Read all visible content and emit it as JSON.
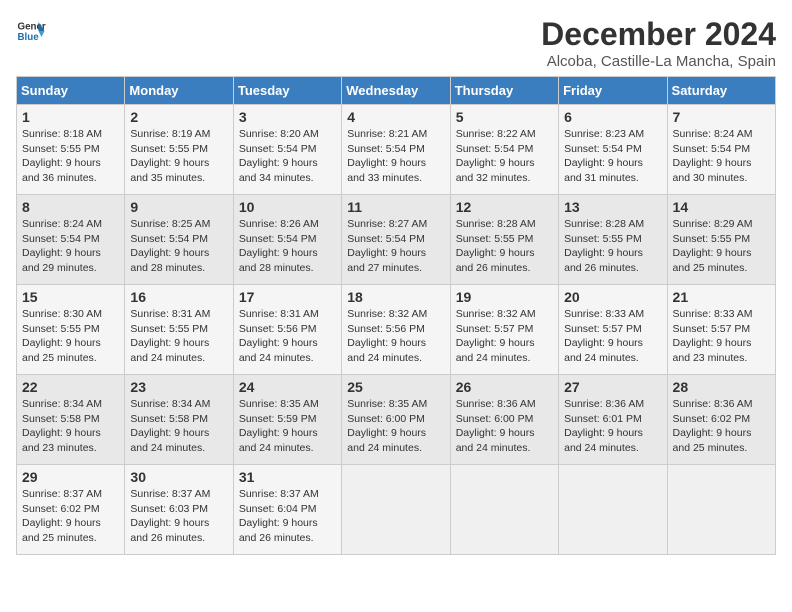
{
  "logo": {
    "line1": "General",
    "line2": "Blue"
  },
  "title": "December 2024",
  "subtitle": "Alcoba, Castille-La Mancha, Spain",
  "days_header": [
    "Sunday",
    "Monday",
    "Tuesday",
    "Wednesday",
    "Thursday",
    "Friday",
    "Saturday"
  ],
  "weeks": [
    [
      {
        "num": "1",
        "info": "Sunrise: 8:18 AM\nSunset: 5:55 PM\nDaylight: 9 hours\nand 36 minutes."
      },
      {
        "num": "2",
        "info": "Sunrise: 8:19 AM\nSunset: 5:55 PM\nDaylight: 9 hours\nand 35 minutes."
      },
      {
        "num": "3",
        "info": "Sunrise: 8:20 AM\nSunset: 5:54 PM\nDaylight: 9 hours\nand 34 minutes."
      },
      {
        "num": "4",
        "info": "Sunrise: 8:21 AM\nSunset: 5:54 PM\nDaylight: 9 hours\nand 33 minutes."
      },
      {
        "num": "5",
        "info": "Sunrise: 8:22 AM\nSunset: 5:54 PM\nDaylight: 9 hours\nand 32 minutes."
      },
      {
        "num": "6",
        "info": "Sunrise: 8:23 AM\nSunset: 5:54 PM\nDaylight: 9 hours\nand 31 minutes."
      },
      {
        "num": "7",
        "info": "Sunrise: 8:24 AM\nSunset: 5:54 PM\nDaylight: 9 hours\nand 30 minutes."
      }
    ],
    [
      {
        "num": "8",
        "info": "Sunrise: 8:24 AM\nSunset: 5:54 PM\nDaylight: 9 hours\nand 29 minutes."
      },
      {
        "num": "9",
        "info": "Sunrise: 8:25 AM\nSunset: 5:54 PM\nDaylight: 9 hours\nand 28 minutes."
      },
      {
        "num": "10",
        "info": "Sunrise: 8:26 AM\nSunset: 5:54 PM\nDaylight: 9 hours\nand 28 minutes."
      },
      {
        "num": "11",
        "info": "Sunrise: 8:27 AM\nSunset: 5:54 PM\nDaylight: 9 hours\nand 27 minutes."
      },
      {
        "num": "12",
        "info": "Sunrise: 8:28 AM\nSunset: 5:55 PM\nDaylight: 9 hours\nand 26 minutes."
      },
      {
        "num": "13",
        "info": "Sunrise: 8:28 AM\nSunset: 5:55 PM\nDaylight: 9 hours\nand 26 minutes."
      },
      {
        "num": "14",
        "info": "Sunrise: 8:29 AM\nSunset: 5:55 PM\nDaylight: 9 hours\nand 25 minutes."
      }
    ],
    [
      {
        "num": "15",
        "info": "Sunrise: 8:30 AM\nSunset: 5:55 PM\nDaylight: 9 hours\nand 25 minutes."
      },
      {
        "num": "16",
        "info": "Sunrise: 8:31 AM\nSunset: 5:55 PM\nDaylight: 9 hours\nand 24 minutes."
      },
      {
        "num": "17",
        "info": "Sunrise: 8:31 AM\nSunset: 5:56 PM\nDaylight: 9 hours\nand 24 minutes."
      },
      {
        "num": "18",
        "info": "Sunrise: 8:32 AM\nSunset: 5:56 PM\nDaylight: 9 hours\nand 24 minutes."
      },
      {
        "num": "19",
        "info": "Sunrise: 8:32 AM\nSunset: 5:57 PM\nDaylight: 9 hours\nand 24 minutes."
      },
      {
        "num": "20",
        "info": "Sunrise: 8:33 AM\nSunset: 5:57 PM\nDaylight: 9 hours\nand 24 minutes."
      },
      {
        "num": "21",
        "info": "Sunrise: 8:33 AM\nSunset: 5:57 PM\nDaylight: 9 hours\nand 23 minutes."
      }
    ],
    [
      {
        "num": "22",
        "info": "Sunrise: 8:34 AM\nSunset: 5:58 PM\nDaylight: 9 hours\nand 23 minutes."
      },
      {
        "num": "23",
        "info": "Sunrise: 8:34 AM\nSunset: 5:58 PM\nDaylight: 9 hours\nand 24 minutes."
      },
      {
        "num": "24",
        "info": "Sunrise: 8:35 AM\nSunset: 5:59 PM\nDaylight: 9 hours\nand 24 minutes."
      },
      {
        "num": "25",
        "info": "Sunrise: 8:35 AM\nSunset: 6:00 PM\nDaylight: 9 hours\nand 24 minutes."
      },
      {
        "num": "26",
        "info": "Sunrise: 8:36 AM\nSunset: 6:00 PM\nDaylight: 9 hours\nand 24 minutes."
      },
      {
        "num": "27",
        "info": "Sunrise: 8:36 AM\nSunset: 6:01 PM\nDaylight: 9 hours\nand 24 minutes."
      },
      {
        "num": "28",
        "info": "Sunrise: 8:36 AM\nSunset: 6:02 PM\nDaylight: 9 hours\nand 25 minutes."
      }
    ],
    [
      {
        "num": "29",
        "info": "Sunrise: 8:37 AM\nSunset: 6:02 PM\nDaylight: 9 hours\nand 25 minutes."
      },
      {
        "num": "30",
        "info": "Sunrise: 8:37 AM\nSunset: 6:03 PM\nDaylight: 9 hours\nand 26 minutes."
      },
      {
        "num": "31",
        "info": "Sunrise: 8:37 AM\nSunset: 6:04 PM\nDaylight: 9 hours\nand 26 minutes."
      },
      {
        "num": "",
        "info": ""
      },
      {
        "num": "",
        "info": ""
      },
      {
        "num": "",
        "info": ""
      },
      {
        "num": "",
        "info": ""
      }
    ]
  ]
}
